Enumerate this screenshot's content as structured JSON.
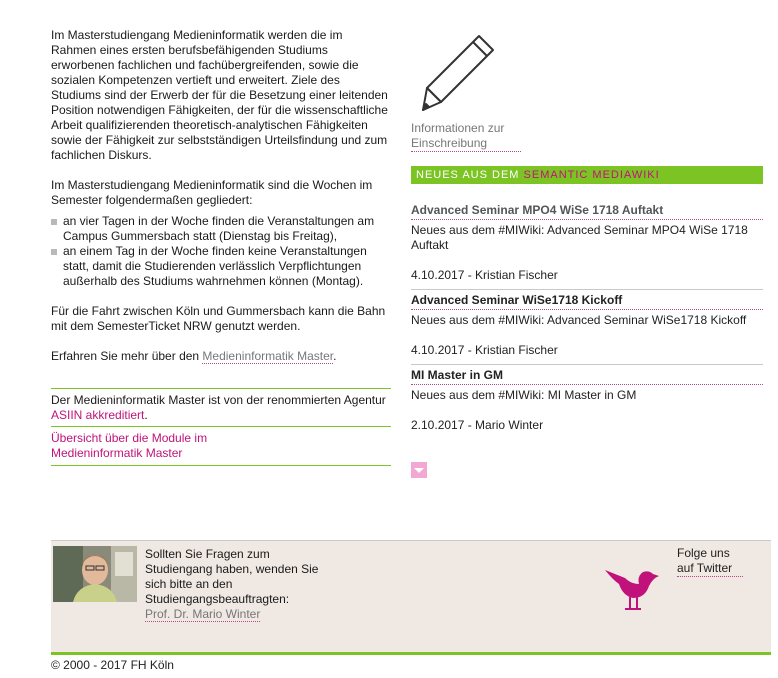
{
  "left": {
    "para1": "Im Masterstudiengang Medieninformatik werden die im Rahmen eines ersten berufsbefähigenden Studiums erworbenen fachlichen und fachübergreifenden, sowie die sozialen Kompetenzen vertieft und erweitert. Ziele des Studiums sind der Erwerb der für die Besetzung einer leitenden Position notwendigen Fähigkeiten, der für die wissenschaftliche Arbeit qualifizierenden theoretisch-analytischen Fähigkeiten sowie der Fähigkeit zur selbstständigen Urteilsfindung und zum fachlichen Diskurs.",
    "para2": "Im Masterstudiengang Medieninformatik sind die Wochen im Semester folgendermaßen gegliedert:",
    "bullets": [
      "an vier Tagen in der Woche finden die Veranstaltungen am Campus Gummersbach statt (Dienstag bis Freitag),",
      "an einem Tag in der Woche finden keine Veranstaltungen statt, damit die Studierenden verlässlich Verpflichtungen außerhalb des Studiums wahrnehmen können (Montag)."
    ],
    "para3": "Für die Fahrt zwischen Köln und Gummersbach kann die Bahn mit dem SemesterTicket NRW genutzt werden.",
    "para4_prefix": "Erfahren Sie mehr über den ",
    "para4_link": "Medieninformatik Master",
    "para4_suffix": ".",
    "accredit_prefix": "Der Medieninformatik Master ist von der renommierten Agentur ",
    "accredit_link": "ASIIN akkreditiert",
    "accredit_suffix": ".",
    "modules_link": "Übersicht über die Module im Medieninformatik Master"
  },
  "right": {
    "info_link": "Informationen zur Einschreibung",
    "news_header_pre": "NEUES AUS DEM ",
    "news_header_link": "SEMANTIC MEDIAWIKI",
    "news": [
      {
        "title": "Advanced Seminar MPO4 WiSe 1718 Auftakt",
        "text": "Neues aus dem #MIWiki: Advanced Seminar MPO4 WiSe 1718 Auftakt",
        "meta": "4.10.2017 - Kristian Fischer"
      },
      {
        "title": "Advanced Seminar WiSe1718 Kickoff",
        "text": "Neues aus dem #MIWiki: Advanced Seminar WiSe1718 Kickoff",
        "meta": "4.10.2017 - Kristian Fischer"
      },
      {
        "title": "MI Master in GM",
        "text": "Neues aus dem #MIWiki: MI Master in GM",
        "meta": "2.10.2017 - Mario Winter"
      }
    ]
  },
  "footer": {
    "contact_text": "Sollten Sie Fragen zum Studiengang haben, wenden Sie sich bitte an den Studiengangsbeauftragten:",
    "contact_link": "Prof. Dr. Mario Winter",
    "twitter_link": "Folge uns auf Twitter",
    "copyright": "© 2000 - 2017 FH Köln"
  },
  "colors": {
    "accent_green": "#7cc424",
    "accent_pink": "#c0127a",
    "footer_bg": "#efe8e3"
  },
  "icons": [
    "pencil-icon",
    "expand-more-icon",
    "twitter-bird-icon"
  ]
}
